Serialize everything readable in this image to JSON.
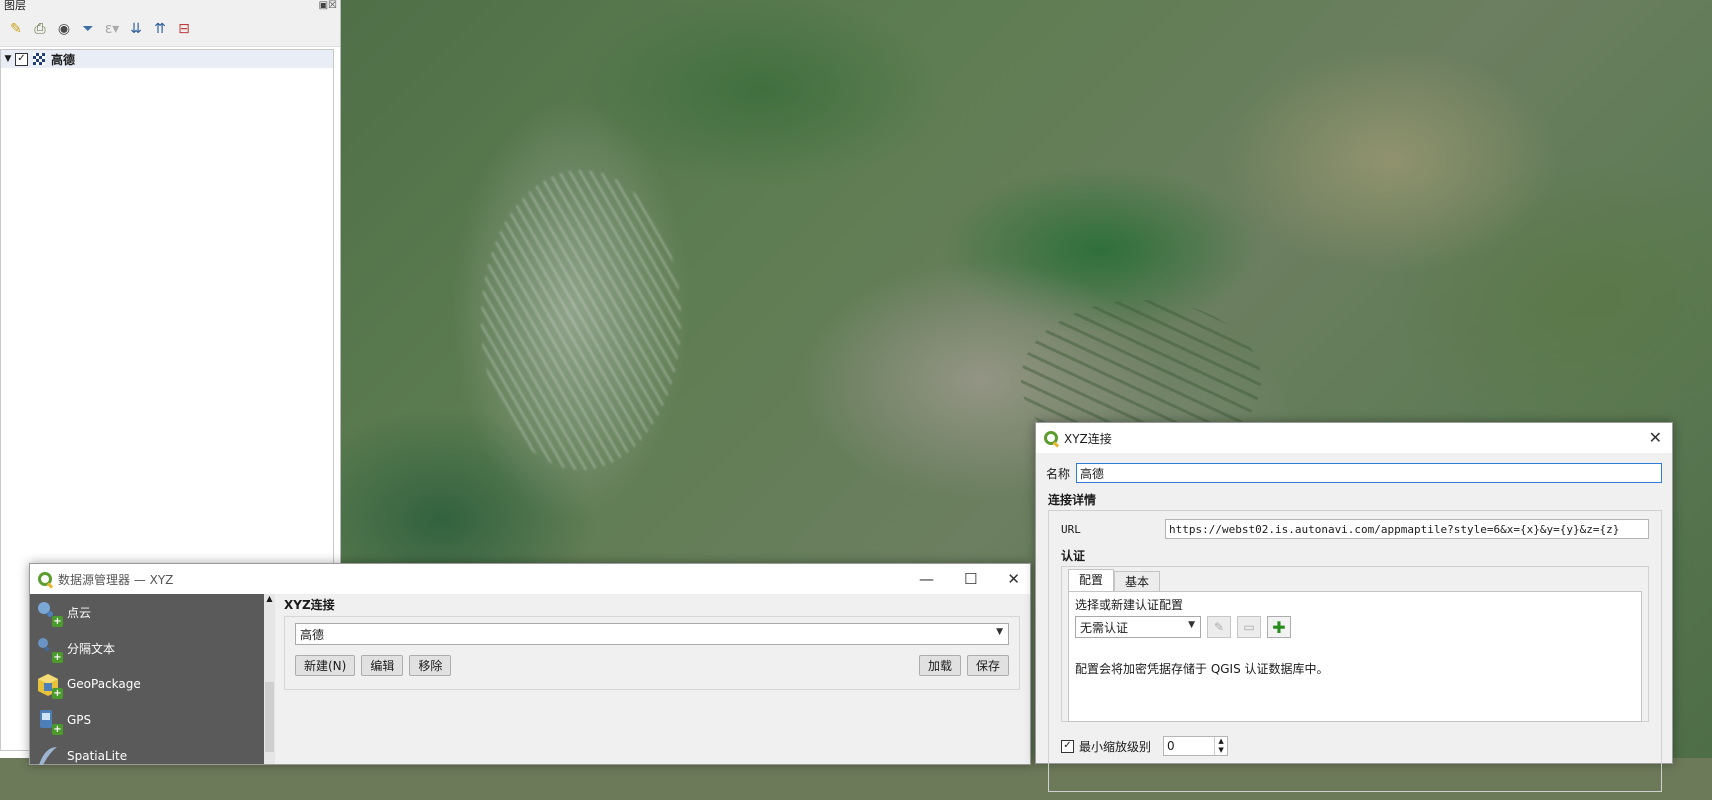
{
  "layers_panel": {
    "title": "图层",
    "toolbar_icons": [
      "style-manager-icon",
      "add-group-icon",
      "eye-icon",
      "filter-icon",
      "filter-expression-icon",
      "expand-all-icon",
      "collapse-all-icon",
      "remove-layer-icon"
    ],
    "layers": [
      {
        "name": "高德",
        "checked": true,
        "expanded": true
      }
    ]
  },
  "data_source_manager": {
    "title": "数据源管理器 — XYZ",
    "window_buttons": {
      "minimize": "—",
      "maximize": "☐",
      "close": "✕"
    },
    "sidebar_items": [
      {
        "label": "点云",
        "icon": "point-cloud-icon"
      },
      {
        "label": "分隔文本",
        "icon": "delimited-text-icon"
      },
      {
        "label": "GeoPackage",
        "icon": "geopackage-icon"
      },
      {
        "label": "GPS",
        "icon": "gps-icon"
      },
      {
        "label": "SpatiaLite",
        "icon": "spatialite-icon"
      }
    ],
    "section_title": "XYZ连接",
    "selected_connection": "高德",
    "buttons": {
      "new": "新建(N)",
      "edit": "编辑",
      "remove": "移除",
      "load": "加载",
      "save": "保存"
    }
  },
  "xyz_dialog": {
    "title": "XYZ连接",
    "close": "✕",
    "name_label": "名称",
    "name_value": "高德",
    "details_title": "连接详情",
    "url_label": "URL",
    "url_value": "https://webst02.is.autonavi.com/appmaptile?style=6&x={x}&y={y}&z={z}",
    "auth_title": "认证",
    "tabs": [
      "配置",
      "基本"
    ],
    "auth_prompt": "选择或新建认证配置",
    "auth_selected": "无需认证",
    "auth_note": "配置会将加密凭据存储于 QGIS 认证数据库中。",
    "min_zoom_label": "最小缩放级别",
    "min_zoom_checked": true,
    "min_zoom_value": "0"
  }
}
